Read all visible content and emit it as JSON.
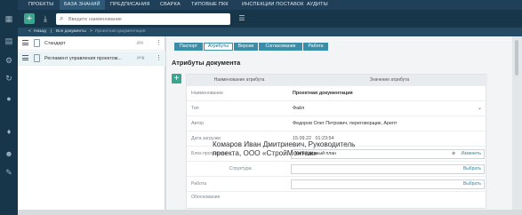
{
  "nav": {
    "items": [
      "ПРОЕКТЫ",
      "БАЗА ЗНАНИЙ",
      "ПРЕДПИСАНИЯ",
      "СВАРКА",
      "ТИПОВЫЕ ПКК",
      "ИНСПЕКЦИИ ПОСТАВОК",
      "АУДИТЫ"
    ],
    "active": "БАЗА ЗНАНИЙ"
  },
  "toolbar": {
    "add_label": "+",
    "search_placeholder": "Введите наименование"
  },
  "breadcrumb": {
    "back": "Назад",
    "root": "Все документы",
    "sep": ">",
    "current": "Проектная документация"
  },
  "list": {
    "items": [
      {
        "name": "Стандарт",
        "ext": ".jpg"
      },
      {
        "name": "Регламент управления проектом...",
        "ext": ".png"
      }
    ]
  },
  "tabs": [
    "Паспорт",
    "Атрибуты",
    "Версии",
    "Согласование",
    "Работа"
  ],
  "active_tab": "Атрибуты",
  "section_title": "Атрибуты документа",
  "grid": {
    "col_name": "Наименование атрибута",
    "col_value": "Значение атрибута",
    "rows": {
      "name": {
        "label": "Наименование",
        "value": "Проектная документация"
      },
      "type": {
        "label": "Тип",
        "value": "Файл"
      },
      "author": {
        "label": "Автор",
        "value": "Федоров Олег Петрович, переговорщик, Арепт"
      },
      "date": {
        "label": "Дата загрузки",
        "value": "15.09.22   01:23:54"
      },
      "program": {
        "label": "Блок программы",
        "value": "Календарный план",
        "clear": "⊗",
        "action": "Изменить"
      },
      "structure": {
        "label": "Структура",
        "action": "Выбрать"
      },
      "work": {
        "label": "Работа",
        "action": "Выбрать"
      },
      "basis": {
        "label": "Обоснование"
      }
    }
  },
  "tooltip": {
    "line1": "Комаров Иван Дмитриевич, Руководитель",
    "line2": "проекта, ООО «СтройМонтаж»"
  },
  "colors": {
    "rail": "#18364a",
    "accent": "#3aa68f",
    "tab": "#3a8ea8"
  }
}
